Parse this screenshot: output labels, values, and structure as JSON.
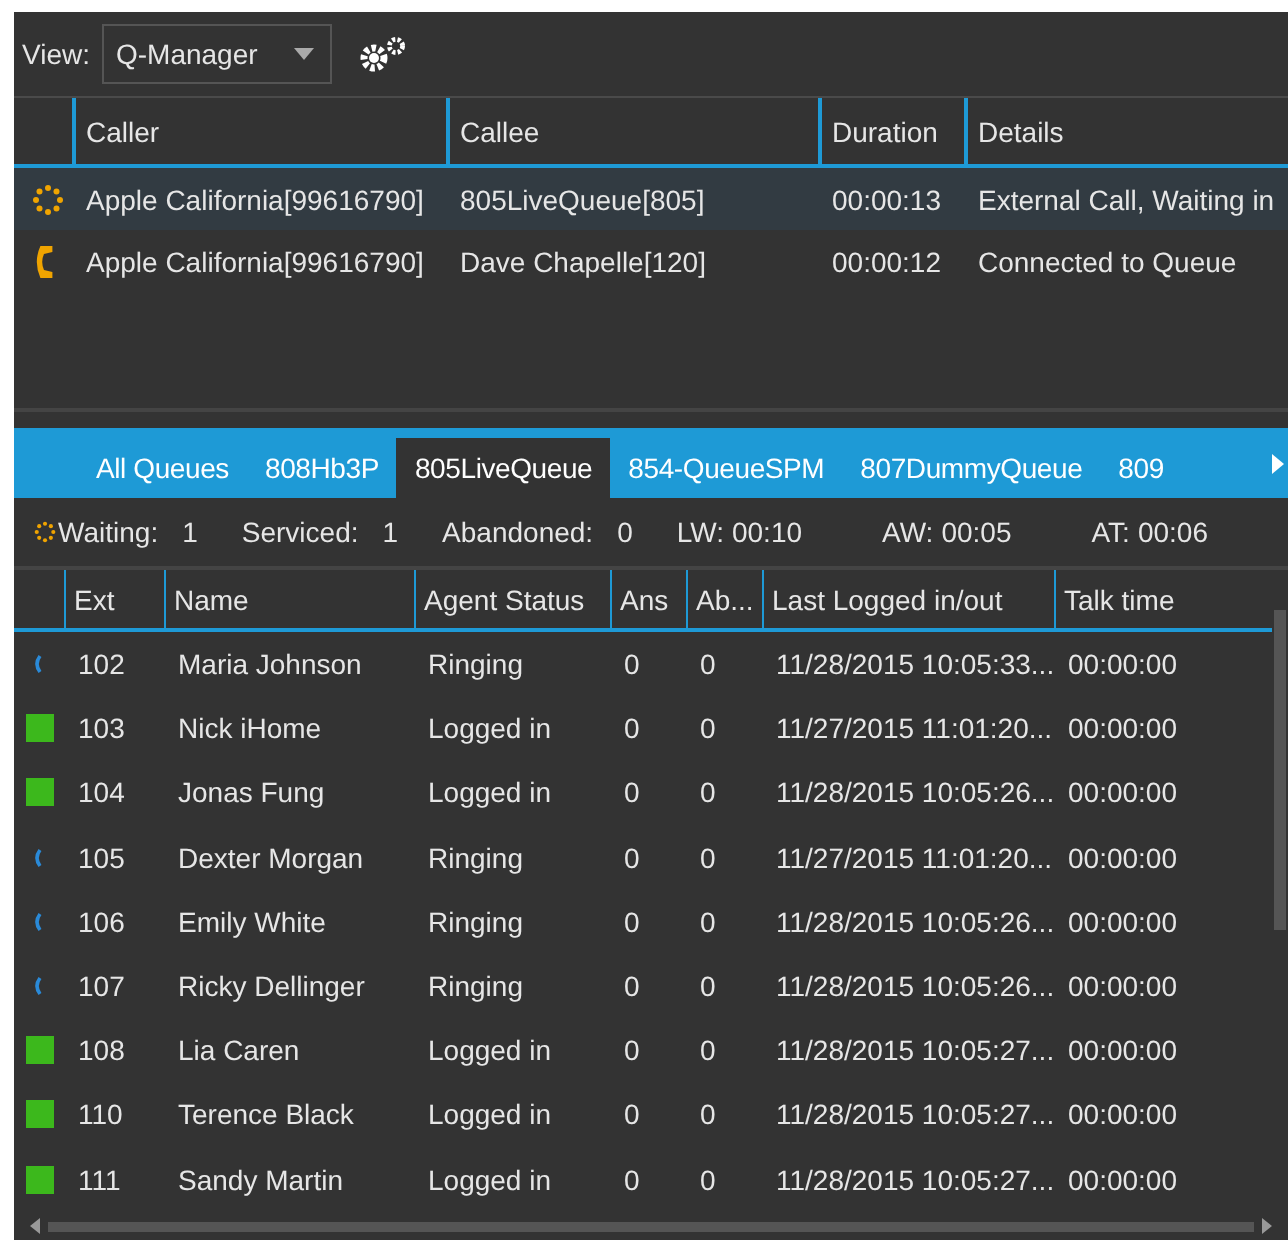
{
  "toolbar": {
    "view_label": "View:",
    "view_value": "Q-Manager"
  },
  "calls": {
    "columns": [
      "Caller",
      "Callee",
      "Duration",
      "Details"
    ],
    "rows": [
      {
        "kind": "waiting",
        "selected": true,
        "caller": "Apple California[99616790]",
        "callee": "805LiveQueue[805]",
        "duration": "00:00:13",
        "details": "External Call, Waiting in"
      },
      {
        "kind": "connected",
        "selected": false,
        "caller": "Apple California[99616790]",
        "callee": "Dave Chapelle[120]",
        "duration": "00:00:12",
        "details": "Connected to Queue"
      }
    ]
  },
  "queue_tabs": [
    {
      "label": "All Queues",
      "selected": false
    },
    {
      "label": "808Hb3P",
      "selected": false
    },
    {
      "label": "805LiveQueue",
      "selected": true
    },
    {
      "label": "854-QueueSPM",
      "selected": false
    },
    {
      "label": "807DummyQueue",
      "selected": false
    },
    {
      "label": "809",
      "selected": false
    }
  ],
  "stats": [
    {
      "label": "Waiting:",
      "value": "1"
    },
    {
      "label": "Serviced:",
      "value": "1"
    },
    {
      "label": "Abandoned:",
      "value": "0"
    },
    {
      "label": "LW:",
      "value": "00:10"
    },
    {
      "label": "AW:",
      "value": "00:05"
    },
    {
      "label": "AT:",
      "value": "00:06"
    }
  ],
  "agents": {
    "columns": [
      "Ext",
      "Name",
      "Agent Status",
      "Ans",
      "Ab...",
      "Last Logged in/out",
      "Talk time"
    ],
    "rows": [
      {
        "kind": "ringing",
        "ext": "102",
        "name": "Maria Johnson",
        "status": "Ringing",
        "ans": "0",
        "ab": "0",
        "last": "11/28/2015 10:05:33...",
        "talk": "00:00:00"
      },
      {
        "kind": "logged-in",
        "ext": "103",
        "name": "Nick iHome",
        "status": "Logged in",
        "ans": "0",
        "ab": "0",
        "last": "11/27/2015 11:01:20...",
        "talk": "00:00:00"
      },
      {
        "kind": "logged-in",
        "ext": "104",
        "name": "Jonas Fung",
        "status": "Logged in",
        "ans": "0",
        "ab": "0",
        "last": "11/28/2015 10:05:26...",
        "talk": "00:00:00"
      },
      {
        "kind": "ringing",
        "ext": "105",
        "name": "Dexter Morgan",
        "status": "Ringing",
        "ans": "0",
        "ab": "0",
        "last": "11/27/2015 11:01:20...",
        "talk": "00:00:00"
      },
      {
        "kind": "ringing",
        "ext": "106",
        "name": "Emily White",
        "status": "Ringing",
        "ans": "0",
        "ab": "0",
        "last": "11/28/2015 10:05:26...",
        "talk": "00:00:00"
      },
      {
        "kind": "ringing",
        "ext": "107",
        "name": "Ricky Dellinger",
        "status": "Ringing",
        "ans": "0",
        "ab": "0",
        "last": "11/28/2015 10:05:26...",
        "talk": "00:00:00"
      },
      {
        "kind": "logged-in",
        "ext": "108",
        "name": "Lia Caren",
        "status": "Logged in",
        "ans": "0",
        "ab": "0",
        "last": "11/28/2015 10:05:27...",
        "talk": "00:00:00"
      },
      {
        "kind": "logged-in",
        "ext": "110",
        "name": "Terence Black",
        "status": "Logged in",
        "ans": "0",
        "ab": "0",
        "last": "11/28/2015 10:05:27...",
        "talk": "00:00:00"
      },
      {
        "kind": "logged-in",
        "ext": "111",
        "name": "Sandy Martin",
        "status": "Logged in",
        "ans": "0",
        "ab": "0",
        "last": "11/28/2015 10:05:27...",
        "talk": "00:00:00"
      }
    ]
  }
}
